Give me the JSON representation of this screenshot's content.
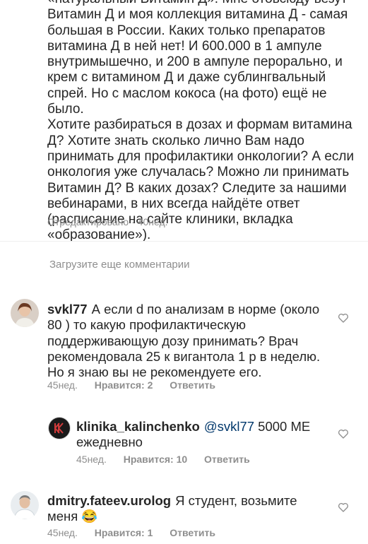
{
  "post": {
    "caption": "«натуральный Витамин Д». Мне  отовсюду везут\nВитамин Д и моя коллекция витамина Д - самая\nбольшая в России. Каких только препаратов\nвитамина  Д в ней нет! И 600.000 в 1 ампуле\nвнутримышечно, и 200 в ампуле перорально, и\nкрем с витамином Д и даже сублингвальный\nспрей. Но с маслом кокоса (на фото) ещё не было.\nХотите разбираться в дозах и формам витамина\nД? Хотите знать сколько лично Вам надо\nпринимать для профилактики онкологии? А если\nонкология уже случалась? Можно ли принимать\nВитамин Д? В каких дозах? Следите за нашими\nвебинарами, в них всегда найдёте ответ\n(расписание на сайте клиники, вкладка\n«образование»).",
    "edited_label": "Отредактировано",
    "separator": "·",
    "time": "40нед."
  },
  "load_more": "Загрузите еще комментарии",
  "comments": [
    {
      "username": "svkl77",
      "text": "А если d по анализам в норме (около\n80 ) то какую профилактическую\nподдерживающую дозу принимать? Врач\nрекомендовала 25 к вигантола 1 р в неделю.\nНо я знаю вы не рекомендуете его.",
      "time": "45нед.",
      "likes": "Нравится: 2",
      "reply": "Ответить"
    },
    {
      "username": "klinika_kalinchenko",
      "mention": "@svkl77",
      "text": " 5000 МЕ\nежедневно",
      "time": "45нед.",
      "likes": "Нравится: 10",
      "reply": "Ответить"
    },
    {
      "username": "dmitry.fateev.urolog",
      "text": "Я студент, возьмите\nменя 😂",
      "time": "45нед.",
      "likes": "Нравится: 1",
      "reply": "Ответить"
    }
  ],
  "colors": {
    "text": "#262626",
    "secondary": "#8e8e8e",
    "mention": "#00376b",
    "divider": "#efefef"
  },
  "icons": {
    "heart": "heart-outline-icon"
  }
}
